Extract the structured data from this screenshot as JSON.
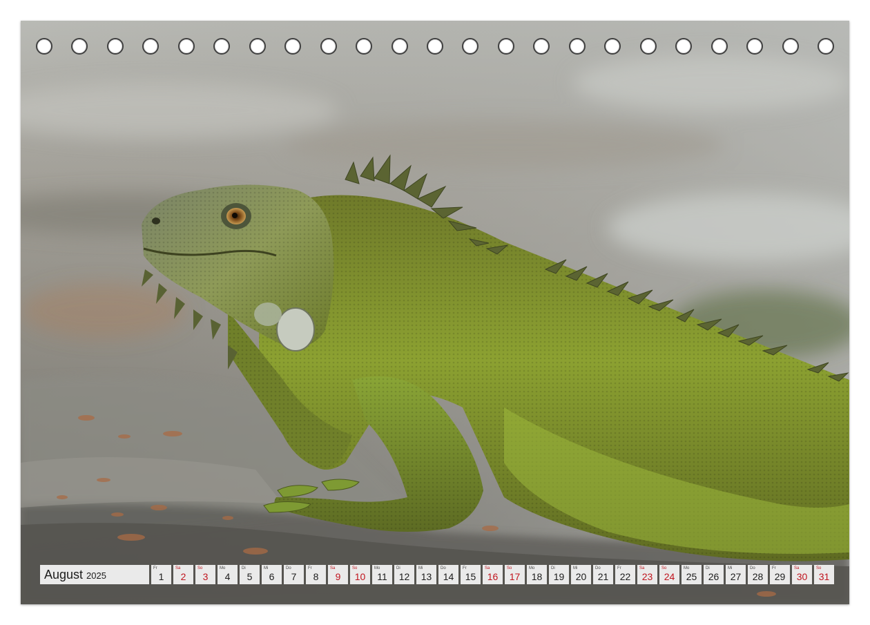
{
  "calendar": {
    "month": "August",
    "year": "2025",
    "days": [
      {
        "wd": "Fr",
        "d": "1",
        "weekend": false
      },
      {
        "wd": "Sa",
        "d": "2",
        "weekend": true
      },
      {
        "wd": "So",
        "d": "3",
        "weekend": true
      },
      {
        "wd": "Mo",
        "d": "4",
        "weekend": false
      },
      {
        "wd": "Di",
        "d": "5",
        "weekend": false
      },
      {
        "wd": "Mi",
        "d": "6",
        "weekend": false
      },
      {
        "wd": "Do",
        "d": "7",
        "weekend": false
      },
      {
        "wd": "Fr",
        "d": "8",
        "weekend": false
      },
      {
        "wd": "Sa",
        "d": "9",
        "weekend": true
      },
      {
        "wd": "So",
        "d": "10",
        "weekend": true
      },
      {
        "wd": "Mo",
        "d": "11",
        "weekend": false
      },
      {
        "wd": "Di",
        "d": "12",
        "weekend": false
      },
      {
        "wd": "Mi",
        "d": "13",
        "weekend": false
      },
      {
        "wd": "Do",
        "d": "14",
        "weekend": false
      },
      {
        "wd": "Fr",
        "d": "15",
        "weekend": false
      },
      {
        "wd": "Sa",
        "d": "16",
        "weekend": true
      },
      {
        "wd": "So",
        "d": "17",
        "weekend": true
      },
      {
        "wd": "Mo",
        "d": "18",
        "weekend": false
      },
      {
        "wd": "Di",
        "d": "19",
        "weekend": false
      },
      {
        "wd": "Mi",
        "d": "20",
        "weekend": false
      },
      {
        "wd": "Do",
        "d": "21",
        "weekend": false
      },
      {
        "wd": "Fr",
        "d": "22",
        "weekend": false
      },
      {
        "wd": "Sa",
        "d": "23",
        "weekend": true
      },
      {
        "wd": "So",
        "d": "24",
        "weekend": true
      },
      {
        "wd": "Mo",
        "d": "25",
        "weekend": false
      },
      {
        "wd": "Di",
        "d": "26",
        "weekend": false
      },
      {
        "wd": "Mi",
        "d": "27",
        "weekend": false
      },
      {
        "wd": "Do",
        "d": "28",
        "weekend": false
      },
      {
        "wd": "Fr",
        "d": "29",
        "weekend": false
      },
      {
        "wd": "Sa",
        "d": "30",
        "weekend": true
      },
      {
        "wd": "So",
        "d": "31",
        "weekend": true
      }
    ]
  },
  "binding_hole_count": 23,
  "colors": {
    "weekend": "#c0141e",
    "iguana_green": "#7c8f2c",
    "rock": "#8a8982"
  }
}
